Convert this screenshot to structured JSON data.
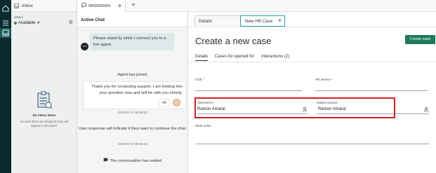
{
  "rail": {
    "icons": [
      "home-icon",
      "menu-icon",
      "inbox-icon"
    ]
  },
  "left_panel": {
    "title": "Inbox",
    "status_label": "Status",
    "status_value": "Available",
    "empty_title": "No inbox items",
    "empty_subtitle": "As work items are assigned, they will appear in this panel."
  },
  "tabs": {
    "interaction_tab": "IMS0000004",
    "add_label": "+"
  },
  "chat": {
    "header": "Active Chat",
    "agent_avatar": "SYS",
    "agent_message": "Please stand by while I connect you to a live agent.",
    "agent_joined": "Agent has joined.",
    "support_message": "Thank you for contacting support. I am looking into your question now and will be with you shortly.",
    "user_message": "Hi",
    "timestamp_1": "2023-07-17 05:48:10",
    "user_response_note": "User response will indicate if they want to continue the chat.",
    "timestamp_2": "2023-07-17 05:52:10",
    "ended": "The conversation has ended."
  },
  "record": {
    "subtab_details": "Details",
    "subtab_new": "New HR Case",
    "title": "Create a new case",
    "create_button": "Create case",
    "form_tabs": [
      "Details",
      "Cases for opened for",
      "Interactions (2)"
    ],
    "fields": {
      "coe_label": "COE",
      "hr_service_label": "HR service",
      "opened_for_label": "Opened for",
      "opened_for_value": "Ramon Amaral",
      "subject_person_label": "Subject person",
      "subject_person_value": "Ramon Amaral",
      "work_notes_label": "Work notes",
      "required_mark": "*"
    }
  },
  "colors": {
    "rail": "#0d2b2f",
    "accent": "#1aa7b5",
    "primary_button": "#1f7a5c",
    "highlight": "#d41f26",
    "available": "#2e8540"
  }
}
